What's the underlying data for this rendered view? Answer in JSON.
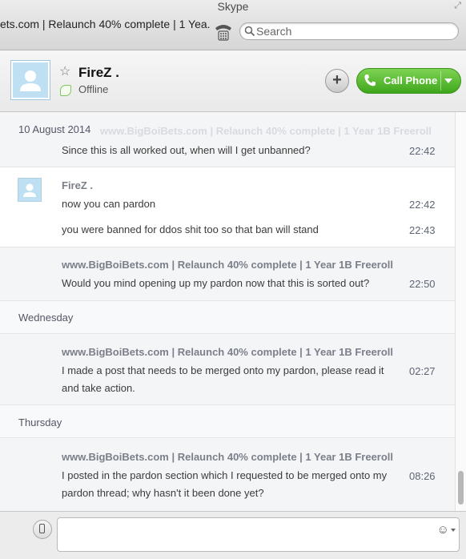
{
  "window": {
    "title": "Skype"
  },
  "toolbar": {
    "mood_message": "ets.com | Relaunch 40% complete | 1 Yea...",
    "search_placeholder": "Search"
  },
  "contact": {
    "name": "FireZ .",
    "status": "Offline",
    "call_label": "Call Phone",
    "status_color": "#7fc75a",
    "call_color": "#4bb426"
  },
  "conversation": {
    "dates": [
      "10 August 2014",
      "Wednesday",
      "Thursday"
    ],
    "ghost_sender": "www.BigBoiBets.com | Relaunch 40% complete | 1 Year 1B Freeroll",
    "groups": [
      {
        "messages": [
          {
            "text": "Since this is all worked out, when will I get unbanned?",
            "time": "22:42"
          }
        ]
      },
      {
        "sender": "FireZ .",
        "messages": [
          {
            "text": "now you can pardon",
            "time": "22:42"
          },
          {
            "text": "you were banned for ddos shit too so that ban will stand",
            "time": "22:43"
          }
        ]
      },
      {
        "sender": "www.BigBoiBets.com | Relaunch 40% complete | 1 Year 1B Freeroll",
        "messages": [
          {
            "text": "Would you mind opening up my pardon now that this is sorted out?",
            "time": "22:50"
          }
        ]
      },
      {
        "sender": "www.BigBoiBets.com | Relaunch 40% complete | 1 Year 1B Freeroll",
        "messages": [
          {
            "text": "I made a post that needs to be merged onto my pardon, please read it and take action.",
            "time": "02:27"
          }
        ]
      },
      {
        "sender": "www.BigBoiBets.com | Relaunch 40% complete | 1 Year 1B Freeroll",
        "messages": [
          {
            "text": "I posted in the pardon section which I requested to be merged onto my pardon thread; why hasn't it been done yet?",
            "time": "08:26"
          }
        ]
      }
    ]
  },
  "icons": {
    "dial": "dial-pad-icon",
    "search": "search-icon",
    "favorite": "star-icon",
    "add": "plus-icon",
    "call": "phone-icon",
    "sms": "mobile-icon",
    "emoticon": "smiley-icon"
  }
}
